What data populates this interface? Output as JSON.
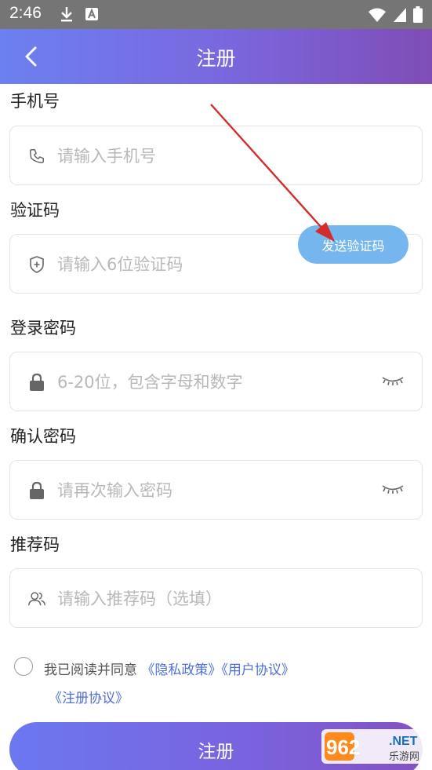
{
  "status_bar": {
    "time": "2:46",
    "icons": [
      "download-icon",
      "a-badge-icon",
      "wifi-icon",
      "signal-icon",
      "battery-icon"
    ]
  },
  "app_bar": {
    "title": "注册",
    "back_icon": "chevron-left-icon"
  },
  "form": {
    "phone": {
      "label": "手机号",
      "placeholder": "请输入手机号",
      "icon": "phone-icon"
    },
    "code": {
      "label": "验证码",
      "placeholder": "请输入6位验证码",
      "icon": "shield-plus-icon",
      "send_button": "发送验证码"
    },
    "password": {
      "label": "登录密码",
      "placeholder": "6-20位，包含字母和数字",
      "icon": "lock-icon",
      "toggle_icon": "eye-closed-icon"
    },
    "confirm": {
      "label": "确认密码",
      "placeholder": "请再次输入密码",
      "icon": "lock-icon",
      "toggle_icon": "eye-closed-icon"
    },
    "referral": {
      "label": "推荐码",
      "placeholder": "请输入推荐码（选填）",
      "icon": "users-icon"
    }
  },
  "agreement": {
    "prefix": "我已阅读并同意",
    "privacy": "《隐私政策》",
    "user": "《用户协议》",
    "register": "《注册协议》"
  },
  "submit_label": "注册",
  "watermark": {
    "number": "962",
    "suffix": ".NET",
    "sub": "乐游网"
  },
  "colors": {
    "accent": "#7a66dc",
    "send_button": "#76b6ee",
    "link": "#4e6fd8",
    "annotation_arrow": "#d42b2b"
  }
}
